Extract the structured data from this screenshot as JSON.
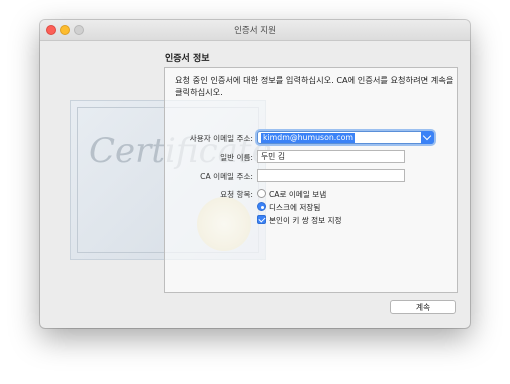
{
  "window": {
    "title": "인증서 지원"
  },
  "section": {
    "title": "인증서 정보"
  },
  "description": "요청 중인 인증서에 대한 정보를 입력하십시오. CA에 인증서를 요청하려면 계속을 클릭하십시오.",
  "form": {
    "email": {
      "label": "사용자 이메일 주소:",
      "value": "kimdm@humuson.com"
    },
    "common_name": {
      "label": "일반 이름:",
      "value": "두민 김"
    },
    "ca_email": {
      "label": "CA 이메일 주소:",
      "value": ""
    },
    "request": {
      "label": "요청 항목:",
      "options": [
        {
          "label": "CA로 이메일 보냄",
          "selected": false
        },
        {
          "label": "디스크에 저장됨",
          "selected": true
        }
      ],
      "checkbox": {
        "label": "본인이 키 쌍 정보 지정",
        "checked": true
      }
    }
  },
  "continue_label": "계속",
  "background": {
    "certificate_text": "Certificate"
  }
}
